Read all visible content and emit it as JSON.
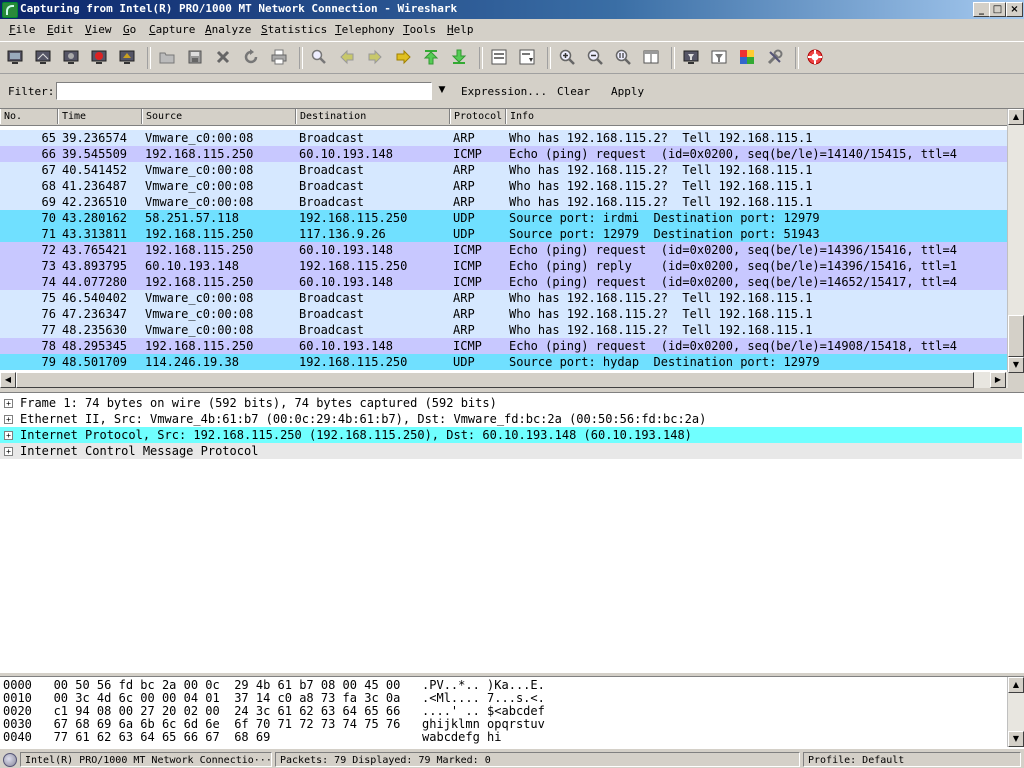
{
  "window": {
    "title": "Capturing from Intel(R) PRO/1000 MT Network Connection - Wireshark",
    "min_glyph": "_",
    "max_glyph": "□",
    "close_glyph": "×"
  },
  "menu": [
    "File",
    "Edit",
    "View",
    "Go",
    "Capture",
    "Analyze",
    "Statistics",
    "Telephony",
    "Tools",
    "Help"
  ],
  "toolbar_icons": [
    "interfaces-icon",
    "options-icon",
    "start-icon",
    "stop-icon",
    "restart-icon",
    "open-icon",
    "save-icon",
    "close-icon",
    "reload-icon",
    "print-icon",
    "find-icon",
    "go-back-icon",
    "go-forward-icon",
    "go-to-icon",
    "first-packet-icon",
    "last-packet-icon",
    "colorize-icon",
    "autoscroll-icon",
    "zoom-in-icon",
    "zoom-out-icon",
    "normal-size-icon",
    "resize-columns-icon",
    "capture-filters-icon",
    "display-filters-icon",
    "coloring-rules-icon",
    "preferences-icon",
    "help-icon"
  ],
  "filter": {
    "label": "Filter:",
    "value": "",
    "expression": "Expression...",
    "clear": "Clear",
    "apply": "Apply"
  },
  "columns": [
    "No.",
    "Time",
    "Source",
    "Destination",
    "Protocol",
    "Info"
  ],
  "packets": [
    {
      "no": "65",
      "time": "39.236574",
      "src": "Vmware_c0:00:08",
      "dst": "Broadcast",
      "proto": "ARP",
      "info": "Who has 192.168.115.2?  Tell 192.168.115.1",
      "kind": "arp"
    },
    {
      "no": "66",
      "time": "39.545509",
      "src": "192.168.115.250",
      "dst": "60.10.193.148",
      "proto": "ICMP",
      "info": "Echo (ping) request  (id=0x0200, seq(be/le)=14140/15415, ttl=4",
      "kind": "icmp"
    },
    {
      "no": "67",
      "time": "40.541452",
      "src": "Vmware_c0:00:08",
      "dst": "Broadcast",
      "proto": "ARP",
      "info": "Who has 192.168.115.2?  Tell 192.168.115.1",
      "kind": "arp"
    },
    {
      "no": "68",
      "time": "41.236487",
      "src": "Vmware_c0:00:08",
      "dst": "Broadcast",
      "proto": "ARP",
      "info": "Who has 192.168.115.2?  Tell 192.168.115.1",
      "kind": "arp"
    },
    {
      "no": "69",
      "time": "42.236510",
      "src": "Vmware_c0:00:08",
      "dst": "Broadcast",
      "proto": "ARP",
      "info": "Who has 192.168.115.2?  Tell 192.168.115.1",
      "kind": "arp"
    },
    {
      "no": "70",
      "time": "43.280162",
      "src": "58.251.57.118",
      "dst": "192.168.115.250",
      "proto": "UDP",
      "info": "Source port: irdmi  Destination port: 12979",
      "kind": "udp"
    },
    {
      "no": "71",
      "time": "43.313811",
      "src": "192.168.115.250",
      "dst": "117.136.9.26",
      "proto": "UDP",
      "info": "Source port: 12979  Destination port: 51943",
      "kind": "udp"
    },
    {
      "no": "72",
      "time": "43.765421",
      "src": "192.168.115.250",
      "dst": "60.10.193.148",
      "proto": "ICMP",
      "info": "Echo (ping) request  (id=0x0200, seq(be/le)=14396/15416, ttl=4",
      "kind": "icmp"
    },
    {
      "no": "73",
      "time": "43.893795",
      "src": "60.10.193.148",
      "dst": "192.168.115.250",
      "proto": "ICMP",
      "info": "Echo (ping) reply    (id=0x0200, seq(be/le)=14396/15416, ttl=1",
      "kind": "icmp"
    },
    {
      "no": "74",
      "time": "44.077280",
      "src": "192.168.115.250",
      "dst": "60.10.193.148",
      "proto": "ICMP",
      "info": "Echo (ping) request  (id=0x0200, seq(be/le)=14652/15417, ttl=4",
      "kind": "icmp"
    },
    {
      "no": "75",
      "time": "46.540402",
      "src": "Vmware_c0:00:08",
      "dst": "Broadcast",
      "proto": "ARP",
      "info": "Who has 192.168.115.2?  Tell 192.168.115.1",
      "kind": "arp"
    },
    {
      "no": "76",
      "time": "47.236347",
      "src": "Vmware_c0:00:08",
      "dst": "Broadcast",
      "proto": "ARP",
      "info": "Who has 192.168.115.2?  Tell 192.168.115.1",
      "kind": "arp"
    },
    {
      "no": "77",
      "time": "48.235630",
      "src": "Vmware_c0:00:08",
      "dst": "Broadcast",
      "proto": "ARP",
      "info": "Who has 192.168.115.2?  Tell 192.168.115.1",
      "kind": "arp"
    },
    {
      "no": "78",
      "time": "48.295345",
      "src": "192.168.115.250",
      "dst": "60.10.193.148",
      "proto": "ICMP",
      "info": "Echo (ping) request  (id=0x0200, seq(be/le)=14908/15418, ttl=4",
      "kind": "icmp"
    },
    {
      "no": "79",
      "time": "48.501709",
      "src": "114.246.19.38",
      "dst": "192.168.115.250",
      "proto": "UDP",
      "info": "Source port: hydap  Destination port: 12979",
      "kind": "udp"
    }
  ],
  "details": [
    {
      "text": "Frame 1: 74 bytes on wire (592 bits), 74 bytes captured (592 bits)",
      "selected": false
    },
    {
      "text": "Ethernet II, Src: Vmware_4b:61:b7 (00:0c:29:4b:61:b7), Dst: Vmware_fd:bc:2a (00:50:56:fd:bc:2a)",
      "selected": false
    },
    {
      "text": "Internet Protocol, Src: 192.168.115.250 (192.168.115.250), Dst: 60.10.193.148 (60.10.193.148)",
      "selected": true
    },
    {
      "text": "Internet Control Message Protocol",
      "selected": false
    }
  ],
  "hex": [
    "0000   00 50 56 fd bc 2a 00 0c  29 4b 61 b7 08 00 45 00   .PV..*.. )Ka...E.",
    "0010   00 3c 4d 6c 00 00 04 01  37 14 c0 a8 73 fa 3c 0a   .<Ml.... 7...s.<.",
    "0020   c1 94 08 00 27 20 02 00  24 3c 61 62 63 64 65 66   ....' .. $<abcdef",
    "0030   67 68 69 6a 6b 6c 6d 6e  6f 70 71 72 73 74 75 76   ghijklmn opqrstuv",
    "0040   77 61 62 63 64 65 66 67  68 69                     wabcdefg hi"
  ],
  "status": {
    "interface": "Intel(R) PRO/1000 MT Network Connectio···",
    "packets": "Packets: 79 Displayed: 79 Marked: 0",
    "profile": "Profile: Default"
  },
  "colors": {
    "arp_row": "#d6e8ff",
    "icmp_row": "#c8c8ff",
    "udp_row": "#70e0ff",
    "selected_detail": "#70ffff"
  }
}
